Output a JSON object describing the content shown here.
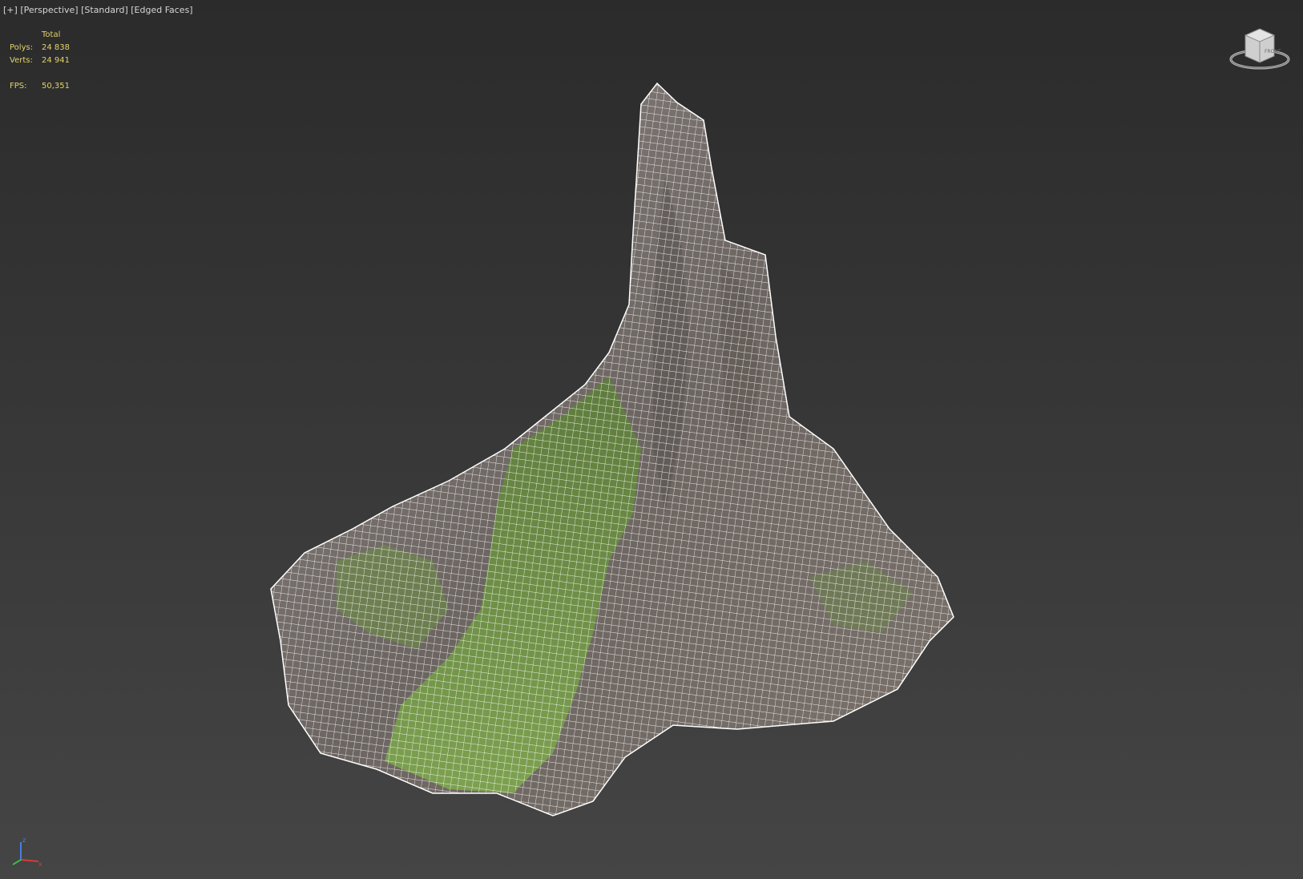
{
  "viewport": {
    "labels": [
      "[+]",
      "[Perspective]",
      "[Standard]",
      "[Edged Faces]"
    ]
  },
  "stats": {
    "header": "Total",
    "polys_label": "Polys:",
    "polys_value": "24 838",
    "verts_label": "Verts:",
    "verts_value": "24 941",
    "fps_label": "FPS:",
    "fps_value": "50,351"
  },
  "viewcube": {
    "face_label": "FRONT",
    "icon": "viewcube-icon"
  },
  "axis": {
    "x_label": "x",
    "z_label": "z",
    "x_color": "#d43c3c",
    "y_color": "#3cba4a",
    "z_color": "#4a7de0"
  },
  "colors": {
    "stats_text": "#e2d36a",
    "label_text": "#d6d6d6",
    "wire": "#ffffff",
    "moss": "#6f9b47",
    "rock": "#7b7470"
  }
}
